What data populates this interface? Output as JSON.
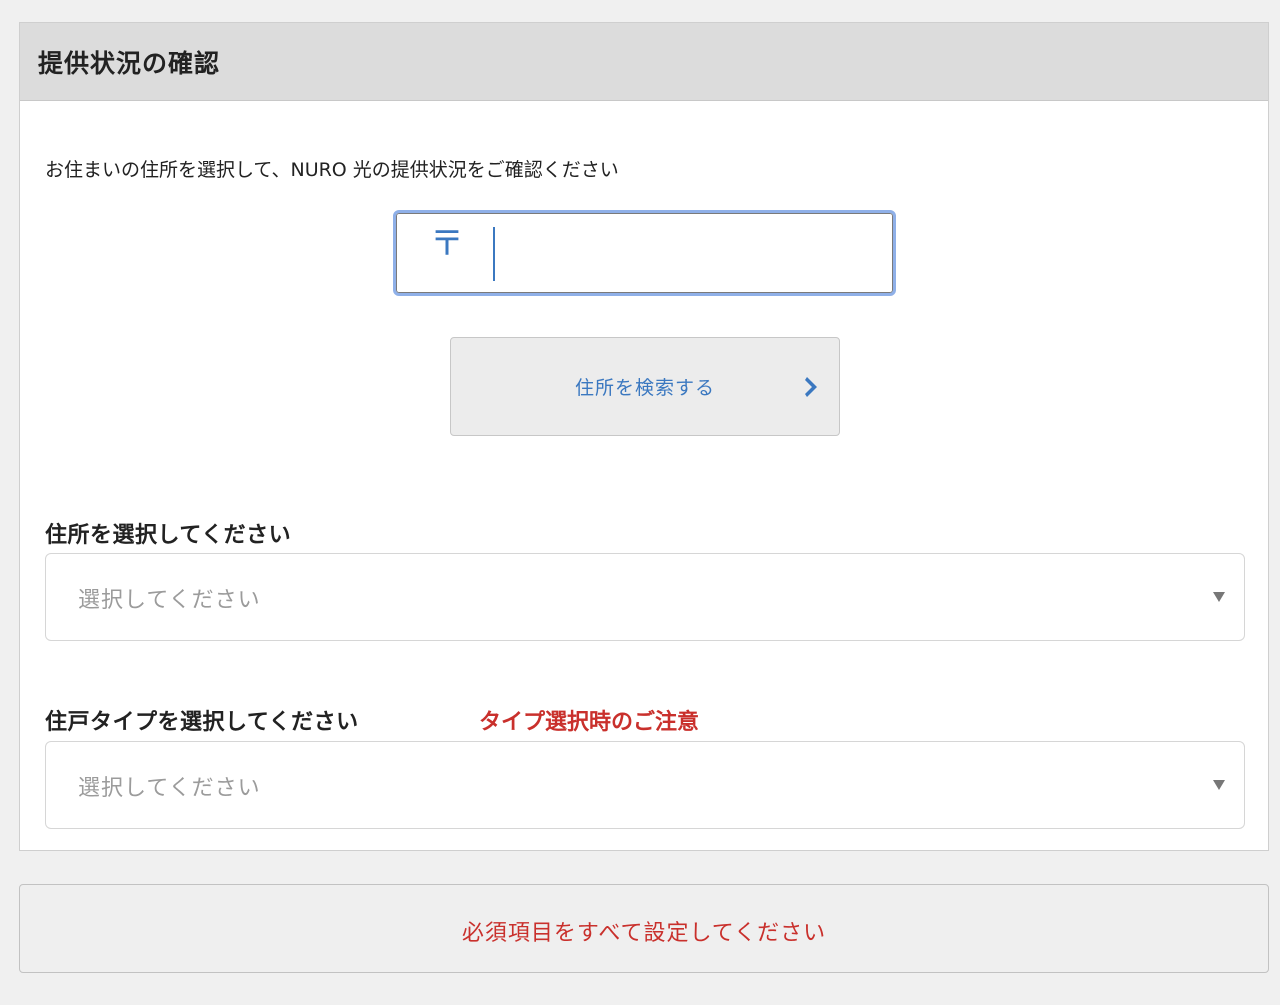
{
  "panel": {
    "title": "提供状況の確認",
    "intro": "お住まいの住所を選択して、NURO 光の提供状況をご確認ください"
  },
  "zip": {
    "mark": "〒",
    "value": "",
    "placeholder": ""
  },
  "search_button": {
    "label": "住所を検索する",
    "arrow_icon": "chevron-right-icon",
    "color": "#3b78c0"
  },
  "address_select": {
    "label": "住所を選択してください",
    "placeholder": "選択してください"
  },
  "dwelling_select": {
    "label": "住戸タイプを選択してください",
    "caution_link": "タイプ選択時のご注意",
    "placeholder": "選択してください"
  },
  "submit": {
    "label": "必須項目をすべて設定してください",
    "color": "#c9302c"
  }
}
